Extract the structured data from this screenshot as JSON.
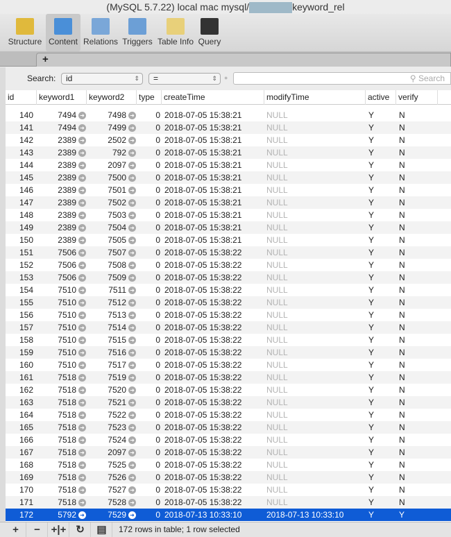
{
  "window": {
    "title_prefix": "(MySQL 5.7.22) local mac mysql/",
    "title_suffix": "keyword_rel"
  },
  "toolbar": {
    "items": [
      {
        "label": "Structure",
        "icon": "structure-icon"
      },
      {
        "label": "Content",
        "icon": "content-icon",
        "active": true
      },
      {
        "label": "Relations",
        "icon": "relations-icon"
      },
      {
        "label": "Triggers",
        "icon": "triggers-icon"
      },
      {
        "label": "Table Info",
        "icon": "table-info-icon"
      },
      {
        "label": "Query",
        "icon": "query-icon"
      }
    ]
  },
  "tabs": {
    "add_label": "+"
  },
  "search": {
    "label": "Search:",
    "field": "id",
    "operator": "=",
    "placeholder": "Search"
  },
  "table": {
    "columns": [
      "id",
      "keyword1",
      "keyword2",
      "type",
      "createTime",
      "modifyTime",
      "active",
      "verify"
    ],
    "rows": [
      [
        "140",
        "7494",
        "7498",
        "0",
        "2018-07-05 15:38:21",
        "NULL",
        "Y",
        "N"
      ],
      [
        "141",
        "7494",
        "7499",
        "0",
        "2018-07-05 15:38:21",
        "NULL",
        "Y",
        "N"
      ],
      [
        "142",
        "2389",
        "2502",
        "0",
        "2018-07-05 15:38:21",
        "NULL",
        "Y",
        "N"
      ],
      [
        "143",
        "2389",
        "792",
        "0",
        "2018-07-05 15:38:21",
        "NULL",
        "Y",
        "N"
      ],
      [
        "144",
        "2389",
        "2097",
        "0",
        "2018-07-05 15:38:21",
        "NULL",
        "Y",
        "N"
      ],
      [
        "145",
        "2389",
        "7500",
        "0",
        "2018-07-05 15:38:21",
        "NULL",
        "Y",
        "N"
      ],
      [
        "146",
        "2389",
        "7501",
        "0",
        "2018-07-05 15:38:21",
        "NULL",
        "Y",
        "N"
      ],
      [
        "147",
        "2389",
        "7502",
        "0",
        "2018-07-05 15:38:21",
        "NULL",
        "Y",
        "N"
      ],
      [
        "148",
        "2389",
        "7503",
        "0",
        "2018-07-05 15:38:21",
        "NULL",
        "Y",
        "N"
      ],
      [
        "149",
        "2389",
        "7504",
        "0",
        "2018-07-05 15:38:21",
        "NULL",
        "Y",
        "N"
      ],
      [
        "150",
        "2389",
        "7505",
        "0",
        "2018-07-05 15:38:21",
        "NULL",
        "Y",
        "N"
      ],
      [
        "151",
        "7506",
        "7507",
        "0",
        "2018-07-05 15:38:22",
        "NULL",
        "Y",
        "N"
      ],
      [
        "152",
        "7506",
        "7508",
        "0",
        "2018-07-05 15:38:22",
        "NULL",
        "Y",
        "N"
      ],
      [
        "153",
        "7506",
        "7509",
        "0",
        "2018-07-05 15:38:22",
        "NULL",
        "Y",
        "N"
      ],
      [
        "154",
        "7510",
        "7511",
        "0",
        "2018-07-05 15:38:22",
        "NULL",
        "Y",
        "N"
      ],
      [
        "155",
        "7510",
        "7512",
        "0",
        "2018-07-05 15:38:22",
        "NULL",
        "Y",
        "N"
      ],
      [
        "156",
        "7510",
        "7513",
        "0",
        "2018-07-05 15:38:22",
        "NULL",
        "Y",
        "N"
      ],
      [
        "157",
        "7510",
        "7514",
        "0",
        "2018-07-05 15:38:22",
        "NULL",
        "Y",
        "N"
      ],
      [
        "158",
        "7510",
        "7515",
        "0",
        "2018-07-05 15:38:22",
        "NULL",
        "Y",
        "N"
      ],
      [
        "159",
        "7510",
        "7516",
        "0",
        "2018-07-05 15:38:22",
        "NULL",
        "Y",
        "N"
      ],
      [
        "160",
        "7510",
        "7517",
        "0",
        "2018-07-05 15:38:22",
        "NULL",
        "Y",
        "N"
      ],
      [
        "161",
        "7518",
        "7519",
        "0",
        "2018-07-05 15:38:22",
        "NULL",
        "Y",
        "N"
      ],
      [
        "162",
        "7518",
        "7520",
        "0",
        "2018-07-05 15:38:22",
        "NULL",
        "Y",
        "N"
      ],
      [
        "163",
        "7518",
        "7521",
        "0",
        "2018-07-05 15:38:22",
        "NULL",
        "Y",
        "N"
      ],
      [
        "164",
        "7518",
        "7522",
        "0",
        "2018-07-05 15:38:22",
        "NULL",
        "Y",
        "N"
      ],
      [
        "165",
        "7518",
        "7523",
        "0",
        "2018-07-05 15:38:22",
        "NULL",
        "Y",
        "N"
      ],
      [
        "166",
        "7518",
        "7524",
        "0",
        "2018-07-05 15:38:22",
        "NULL",
        "Y",
        "N"
      ],
      [
        "167",
        "7518",
        "2097",
        "0",
        "2018-07-05 15:38:22",
        "NULL",
        "Y",
        "N"
      ],
      [
        "168",
        "7518",
        "7525",
        "0",
        "2018-07-05 15:38:22",
        "NULL",
        "Y",
        "N"
      ],
      [
        "169",
        "7518",
        "7526",
        "0",
        "2018-07-05 15:38:22",
        "NULL",
        "Y",
        "N"
      ],
      [
        "170",
        "7518",
        "7527",
        "0",
        "2018-07-05 15:38:22",
        "NULL",
        "Y",
        "N"
      ],
      [
        "171",
        "7518",
        "7528",
        "0",
        "2018-07-05 15:38:22",
        "NULL",
        "Y",
        "N"
      ],
      [
        "172",
        "5792",
        "7529",
        "0",
        "2018-07-13 10:33:10",
        "2018-07-13 10:33:10",
        "Y",
        "Y"
      ]
    ],
    "selected_id": "172"
  },
  "footer": {
    "buttons": [
      {
        "label": "+",
        "name": "add-row-button"
      },
      {
        "label": "−",
        "name": "delete-row-button"
      },
      {
        "label": "+|+",
        "name": "duplicate-row-button"
      },
      {
        "label": "↻",
        "name": "refresh-button"
      },
      {
        "label": "▤",
        "name": "export-button"
      }
    ],
    "status": "172 rows in table; 1 row selected"
  },
  "colors": {
    "selection": "#0f5cd6",
    "null_text": "#b3b3b3"
  }
}
